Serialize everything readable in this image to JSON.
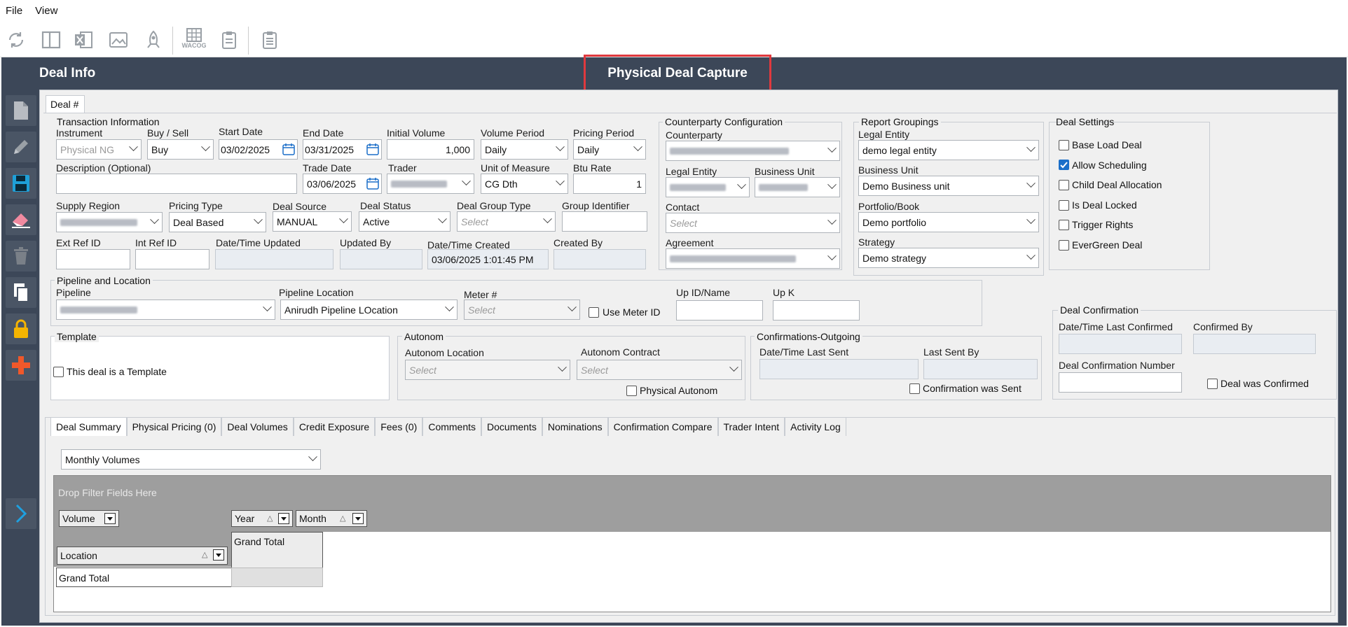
{
  "menu": {
    "file": "File",
    "view": "View"
  },
  "toolbar": {
    "wacog_label": "WACOG"
  },
  "header": {
    "left_title": "Deal Info",
    "center_title": "Physical Deal Capture",
    "highlight_color": "#e0393e"
  },
  "deal_tab": "Deal #",
  "transaction": {
    "group_title": "Transaction Information",
    "instrument_label": "Instrument",
    "instrument_value": "Physical NG",
    "buy_sell_label": "Buy / Sell",
    "buy_sell_value": "Buy",
    "start_date_label": "Start Date",
    "start_date_value": "03/02/2025",
    "end_date_label": "End Date",
    "end_date_value": "03/31/2025",
    "initial_volume_label": "Initial Volume",
    "initial_volume_value": "1,000",
    "volume_period_label": "Volume Period",
    "volume_period_value": "Daily",
    "pricing_period_label": "Pricing Period",
    "pricing_period_value": "Daily",
    "description_label": "Description (Optional)",
    "description_value": "",
    "trade_date_label": "Trade Date",
    "trade_date_value": "03/06/2025",
    "trader_label": "Trader",
    "uom_label": "Unit of Measure",
    "uom_value": "CG Dth",
    "btu_rate_label": "Btu Rate",
    "btu_rate_value": "1",
    "supply_region_label": "Supply Region",
    "pricing_type_label": "Pricing Type",
    "pricing_type_value": "Deal Based",
    "deal_source_label": "Deal Source",
    "deal_source_value": "MANUAL",
    "deal_status_label": "Deal Status",
    "deal_status_value": "Active",
    "deal_group_type_label": "Deal Group Type",
    "deal_group_type_placeholder": "Select",
    "group_identifier_label": "Group Identifier",
    "ext_ref_label": "Ext Ref ID",
    "int_ref_label": "Int Ref ID",
    "dt_updated_label": "Date/Time Updated",
    "updated_by_label": "Updated By",
    "dt_created_label": "Date/Time Created",
    "dt_created_value": "03/06/2025 1:01:45 PM",
    "created_by_label": "Created By"
  },
  "counterparty": {
    "group_title": "Counterparty Configuration",
    "counterparty_label": "Counterparty",
    "legal_entity_label": "Legal Entity",
    "business_unit_label": "Business Unit",
    "contact_label": "Contact",
    "contact_placeholder": "Select",
    "agreement_label": "Agreement"
  },
  "report": {
    "group_title": "Report Groupings",
    "legal_entity_label": "Legal Entity",
    "legal_entity_value": "demo legal entity",
    "business_unit_label": "Business Unit",
    "business_unit_value": "Demo Business unit",
    "portfolio_label": "Portfolio/Book",
    "portfolio_value": "Demo portfolio",
    "strategy_label": "Strategy",
    "strategy_value": "Demo strategy"
  },
  "settings": {
    "group_title": "Deal Settings",
    "items": [
      {
        "label": "Base Load Deal",
        "checked": false
      },
      {
        "label": "Allow Scheduling",
        "checked": true
      },
      {
        "label": "Child Deal Allocation",
        "checked": false
      },
      {
        "label": "Is Deal Locked",
        "checked": false
      },
      {
        "label": "Trigger Rights",
        "checked": false
      },
      {
        "label": "EverGreen Deal",
        "checked": false
      }
    ]
  },
  "pipeline": {
    "group_title": "Pipeline and Location",
    "pipeline_label": "Pipeline",
    "location_label": "Pipeline Location",
    "location_value": "Anirudh Pipeline LOcation",
    "meter_label": "Meter #",
    "meter_placeholder": "Select",
    "use_meter_label": "Use Meter ID",
    "up_id_label": "Up ID/Name",
    "up_k_label": "Up K"
  },
  "confirmation": {
    "group_title": "Deal Confirmation",
    "last_confirmed_label": "Date/Time Last Confirmed",
    "confirmed_by_label": "Confirmed By",
    "number_label": "Deal Confirmation Number",
    "was_confirmed_label": "Deal was Confirmed"
  },
  "template": {
    "group_title": "Template",
    "checkbox_label": "This deal is a Template"
  },
  "autonom": {
    "group_title": "Autonom",
    "location_label": "Autonom Location",
    "location_placeholder": "Select",
    "contract_label": "Autonom Contract",
    "contract_placeholder": "Select",
    "physical_label": "Physical Autonom"
  },
  "outgoing": {
    "group_title": "Confirmations-Outgoing",
    "last_sent_label": "Date/Time Last Sent",
    "last_sent_by_label": "Last Sent By",
    "was_sent_label": "Confirmation was Sent"
  },
  "bottom_tabs": [
    "Deal Summary",
    "Physical Pricing (0)",
    "Deal Volumes",
    "Credit Exposure",
    "Fees (0)",
    "Comments",
    "Documents",
    "Nominations",
    "Confirmation Compare",
    "Trader Intent",
    "Activity Log"
  ],
  "summary": {
    "view_select": "Monthly Volumes",
    "drop_filter": "Drop Filter Fields Here",
    "volume_field": "Volume",
    "year_field": "Year",
    "month_field": "Month",
    "location_field": "Location",
    "grand_total_col": "Grand Total",
    "grand_total_row": "Grand Total"
  }
}
